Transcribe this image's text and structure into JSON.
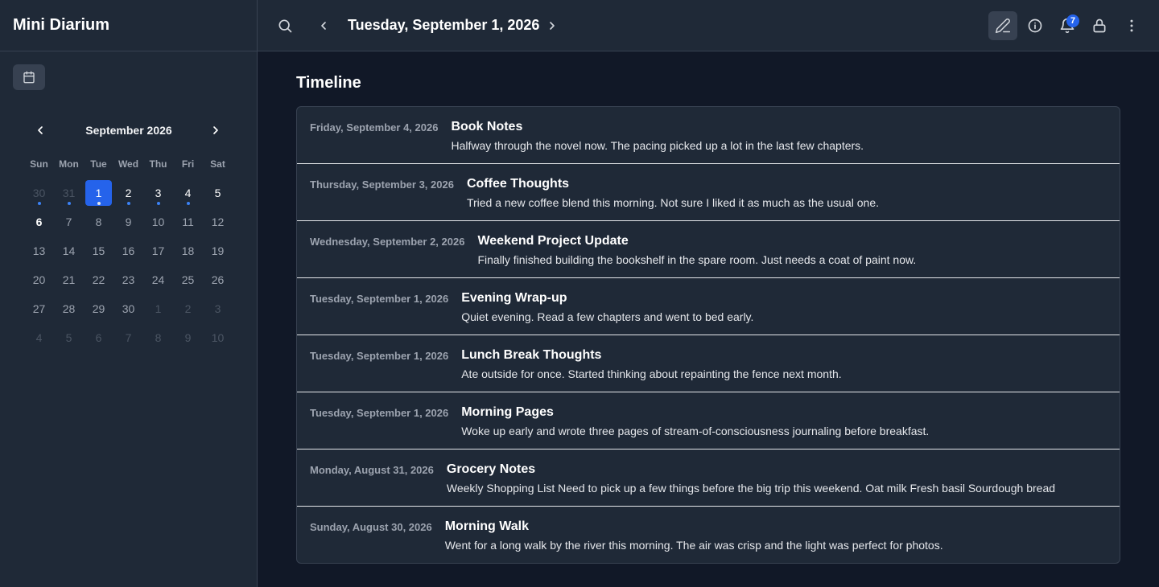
{
  "app": {
    "title": "Mini Diarium"
  },
  "header": {
    "date": "Tuesday, September 1, 2026",
    "notification_count": "7"
  },
  "calendar": {
    "month_label": "September 2026",
    "weekdays": [
      "Sun",
      "Mon",
      "Tue",
      "Wed",
      "Thu",
      "Fri",
      "Sat"
    ],
    "days": [
      {
        "d": "30",
        "state": "out",
        "dot": true
      },
      {
        "d": "31",
        "state": "out",
        "dot": true
      },
      {
        "d": "1",
        "state": "selected",
        "dot": true
      },
      {
        "d": "2",
        "state": "bright",
        "dot": true
      },
      {
        "d": "3",
        "state": "bright",
        "dot": true
      },
      {
        "d": "4",
        "state": "bright",
        "dot": true
      },
      {
        "d": "5",
        "state": "bright",
        "dot": false
      },
      {
        "d": "6",
        "state": "bold",
        "dot": false
      },
      {
        "d": "7",
        "state": "normal",
        "dot": false
      },
      {
        "d": "8",
        "state": "normal",
        "dot": false
      },
      {
        "d": "9",
        "state": "normal",
        "dot": false
      },
      {
        "d": "10",
        "state": "normal",
        "dot": false
      },
      {
        "d": "11",
        "state": "normal",
        "dot": false
      },
      {
        "d": "12",
        "state": "normal",
        "dot": false
      },
      {
        "d": "13",
        "state": "normal",
        "dot": false
      },
      {
        "d": "14",
        "state": "normal",
        "dot": false
      },
      {
        "d": "15",
        "state": "normal",
        "dot": false
      },
      {
        "d": "16",
        "state": "normal",
        "dot": false
      },
      {
        "d": "17",
        "state": "normal",
        "dot": false
      },
      {
        "d": "18",
        "state": "normal",
        "dot": false
      },
      {
        "d": "19",
        "state": "normal",
        "dot": false
      },
      {
        "d": "20",
        "state": "normal",
        "dot": false
      },
      {
        "d": "21",
        "state": "normal",
        "dot": false
      },
      {
        "d": "22",
        "state": "normal",
        "dot": false
      },
      {
        "d": "23",
        "state": "normal",
        "dot": false
      },
      {
        "d": "24",
        "state": "normal",
        "dot": false
      },
      {
        "d": "25",
        "state": "normal",
        "dot": false
      },
      {
        "d": "26",
        "state": "normal",
        "dot": false
      },
      {
        "d": "27",
        "state": "normal",
        "dot": false
      },
      {
        "d": "28",
        "state": "normal",
        "dot": false
      },
      {
        "d": "29",
        "state": "normal",
        "dot": false
      },
      {
        "d": "30",
        "state": "normal",
        "dot": false
      },
      {
        "d": "1",
        "state": "dim",
        "dot": false
      },
      {
        "d": "2",
        "state": "dim",
        "dot": false
      },
      {
        "d": "3",
        "state": "dim",
        "dot": false
      },
      {
        "d": "4",
        "state": "dim",
        "dot": false
      },
      {
        "d": "5",
        "state": "dim",
        "dot": false
      },
      {
        "d": "6",
        "state": "dim",
        "dot": false
      },
      {
        "d": "7",
        "state": "dim",
        "dot": false
      },
      {
        "d": "8",
        "state": "dim",
        "dot": false
      },
      {
        "d": "9",
        "state": "dim",
        "dot": false
      },
      {
        "d": "10",
        "state": "dim",
        "dot": false
      }
    ]
  },
  "timeline": {
    "heading": "Timeline",
    "entries": [
      {
        "date": "Friday, September 4, 2026",
        "title": "Book Notes",
        "text": "Halfway through the novel now. The pacing picked up a lot in the last few chapters."
      },
      {
        "date": "Thursday, September 3, 2026",
        "title": "Coffee Thoughts",
        "text": "Tried a new coffee blend this morning. Not sure I liked it as much as the usual one."
      },
      {
        "date": "Wednesday, September 2, 2026",
        "title": "Weekend Project Update",
        "text": "Finally finished building the bookshelf in the spare room. Just needs a coat of paint now."
      },
      {
        "date": "Tuesday, September 1, 2026",
        "title": "Evening Wrap-up",
        "text": "Quiet evening. Read a few chapters and went to bed early."
      },
      {
        "date": "Tuesday, September 1, 2026",
        "title": "Lunch Break Thoughts",
        "text": "Ate outside for once. Started thinking about repainting the fence next month."
      },
      {
        "date": "Tuesday, September 1, 2026",
        "title": "Morning Pages",
        "text": "Woke up early and wrote three pages of stream-of-consciousness journaling before breakfast."
      },
      {
        "date": "Monday, August 31, 2026",
        "title": "Grocery Notes",
        "text": "Weekly Shopping List Need to pick up a few things before the big trip this weekend. Oat milk Fresh basil Sourdough bread"
      },
      {
        "date": "Sunday, August 30, 2026",
        "title": "Morning Walk",
        "text": "Went for a long walk by the river this morning. The air was crisp and the light was perfect for photos."
      }
    ]
  },
  "icons": {
    "search": "search-icon",
    "prev": "chevron-left-icon",
    "next": "chevron-right-icon",
    "edit": "pencil-icon",
    "info": "info-icon",
    "notifications": "bell-icon",
    "lock": "lock-icon",
    "menu": "more-vertical-icon",
    "calendar": "calendar-icon"
  },
  "colors": {
    "accent": "#2563eb",
    "dot": "#3b82f6",
    "sidebar_bg": "#1f2937",
    "main_bg": "#111827"
  }
}
